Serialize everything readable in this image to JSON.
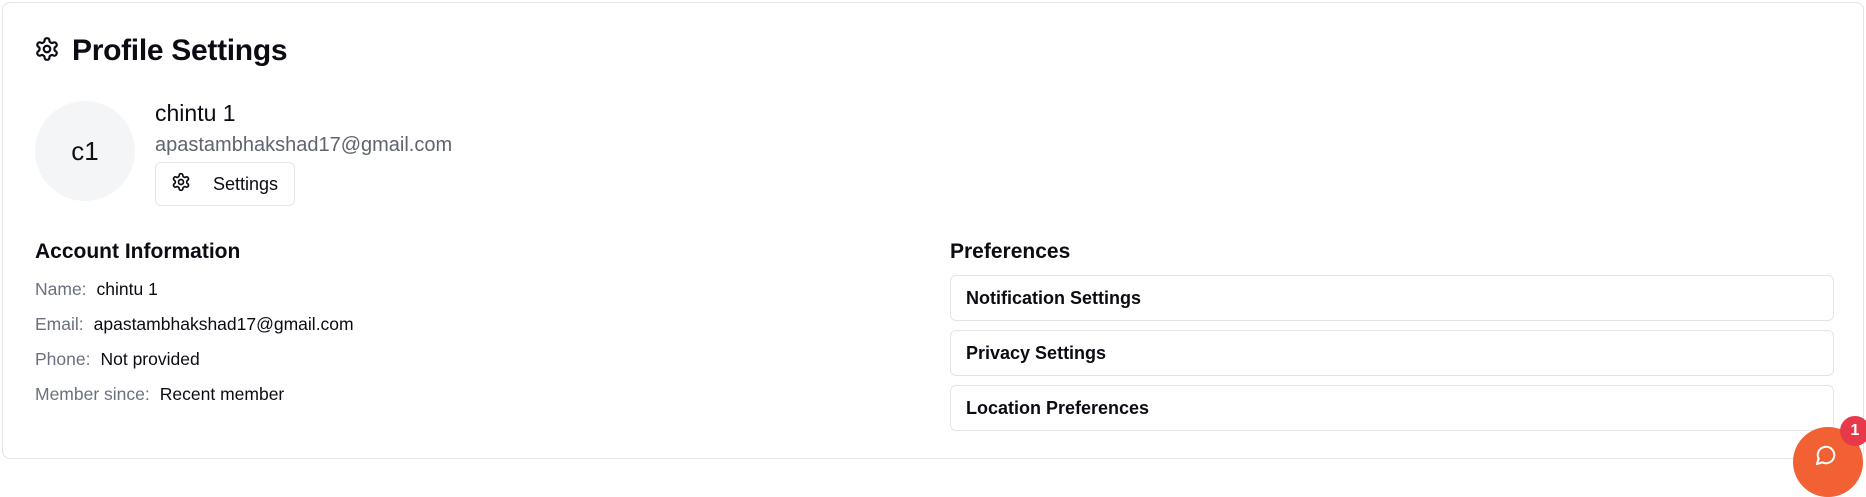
{
  "page": {
    "title": "Profile Settings"
  },
  "profile": {
    "avatar_initials": "c1",
    "name": "chintu 1",
    "email": "apastambhakshad17@gmail.com",
    "settings_button_label": "Settings"
  },
  "account_information": {
    "title": "Account Information",
    "fields": [
      {
        "label": "Name:",
        "value": "chintu 1"
      },
      {
        "label": "Email:",
        "value": "apastambhakshad17@gmail.com"
      },
      {
        "label": "Phone:",
        "value": "Not provided"
      },
      {
        "label": "Member since:",
        "value": "Recent member"
      }
    ]
  },
  "preferences": {
    "title": "Preferences",
    "items": [
      {
        "label": "Notification Settings"
      },
      {
        "label": "Privacy Settings"
      },
      {
        "label": "Location Preferences"
      }
    ]
  },
  "chat": {
    "badge_count": "1",
    "icon": "chat-bubble-icon",
    "color": "#f26134",
    "badge_color": "#e8394a"
  },
  "icons": {
    "title": "gear-icon",
    "settings_button": "gear-icon"
  }
}
